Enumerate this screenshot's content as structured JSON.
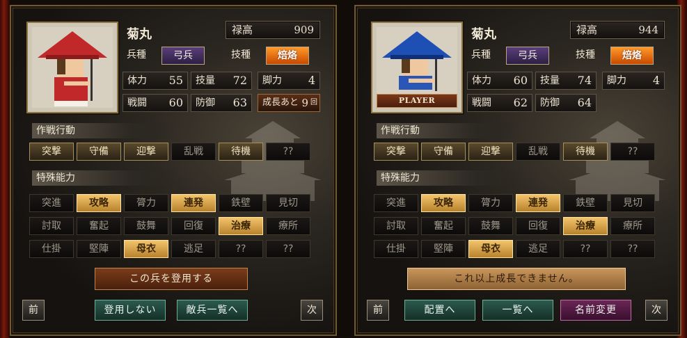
{
  "panels": [
    {
      "name": "菊丸",
      "salary_label": "禄高",
      "salary": "909",
      "troop_label": "兵種",
      "troop": "弓兵",
      "skill_label": "技種",
      "skill": "焙烙",
      "stats": {
        "hp_label": "体力",
        "hp": "55",
        "tech_label": "技量",
        "tech": "72",
        "leg_label": "脚力",
        "leg": "4",
        "atk_label": "戦闘",
        "atk": "60",
        "def_label": "防御",
        "def": "63"
      },
      "growth_label": "成長あと",
      "growth_value": "9",
      "growth_unit": "回",
      "tactics_title": "作戦行動",
      "tactics": [
        "突撃",
        "守備",
        "迎撃",
        "乱戦",
        "待機",
        "??"
      ],
      "tactics_state": [
        "on",
        "on",
        "on",
        "dim",
        "on",
        "dim"
      ],
      "abilities_title": "特殊能力",
      "abilities": [
        "突進",
        "攻略",
        "膂力",
        "連発",
        "鉄壁",
        "見切",
        "討取",
        "奮起",
        "鼓舞",
        "回復",
        "治療",
        "療所",
        "仕掛",
        "堅陣",
        "母衣",
        "逃足",
        "??",
        "??"
      ],
      "abilities_state": [
        "dim",
        "hi",
        "dim",
        "hi",
        "dim",
        "dim",
        "dim",
        "dim",
        "dim",
        "dim",
        "hi",
        "dim",
        "dim",
        "dim",
        "hi",
        "dim",
        "dim",
        "dim"
      ],
      "main_button": "この兵を登用する",
      "prev": "前",
      "next": "次",
      "actions": [
        "登用しない",
        "敵兵一覧へ"
      ],
      "hat_color": "#c0282a",
      "body_color": "#c0282a"
    },
    {
      "name": "菊丸",
      "salary_label": "禄高",
      "salary": "944",
      "troop_label": "兵種",
      "troop": "弓兵",
      "skill_label": "技種",
      "skill": "焙烙",
      "player_tag": "PLAYER",
      "stats": {
        "hp_label": "体力",
        "hp": "60",
        "tech_label": "技量",
        "tech": "74",
        "leg_label": "脚力",
        "leg": "4",
        "atk_label": "戦闘",
        "atk": "62",
        "def_label": "防御",
        "def": "64"
      },
      "tactics_title": "作戦行動",
      "tactics": [
        "突撃",
        "守備",
        "迎撃",
        "乱戦",
        "待機",
        "??"
      ],
      "tactics_state": [
        "on",
        "on",
        "on",
        "dim",
        "on",
        "dim"
      ],
      "abilities_title": "特殊能力",
      "abilities": [
        "突進",
        "攻略",
        "膂力",
        "連発",
        "鉄壁",
        "見切",
        "討取",
        "奮起",
        "鼓舞",
        "回復",
        "治療",
        "療所",
        "仕掛",
        "堅陣",
        "母衣",
        "逃足",
        "??",
        "??"
      ],
      "abilities_state": [
        "dim",
        "hi",
        "dim",
        "hi",
        "dim",
        "dim",
        "dim",
        "dim",
        "dim",
        "dim",
        "hi",
        "dim",
        "dim",
        "dim",
        "hi",
        "dim",
        "dim",
        "dim"
      ],
      "main_button": "これ以上成長できません。",
      "prev": "前",
      "next": "次",
      "actions": [
        "配置へ",
        "一覧へ",
        "名前変更"
      ],
      "hat_color": "#1e4fb4",
      "body_color": "#2a56b8"
    }
  ]
}
